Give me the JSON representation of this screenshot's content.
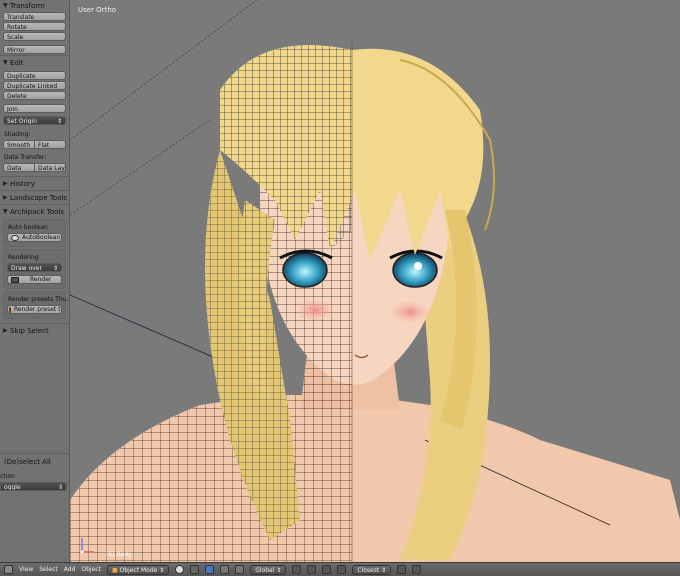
{
  "toolshelf": {
    "transform": {
      "title": "Transform",
      "buttons": [
        "Translate",
        "Rotate",
        "Scale",
        "Mirror"
      ]
    },
    "edit": {
      "title": "Edit",
      "buttons": [
        "Duplicate",
        "Duplicate Linked",
        "Delete",
        "Join"
      ],
      "set_origin": "Set Origin",
      "shading_label": "Shading:",
      "smooth": "Smooth",
      "flat": "Flat",
      "data_transfer_label": "Data Transfer:",
      "data": "Data",
      "data_layo": "Data Layo"
    },
    "history": "History",
    "landscape_tools": "Landscape Tools",
    "archipack": {
      "title": "Archipack Tools",
      "auto_boolean_label": "Auto boolean",
      "auto_boolean_button": "AutoBoolean",
      "rendering_label": "Rendering",
      "draw_over": "Draw over",
      "render_button": "Render",
      "render_presets_label": "Render presets Thu...",
      "render_preset_button": "Render preset th..."
    },
    "skip_select": "Skip Select",
    "operator": {
      "title": "(De)select All",
      "action_label": "ction",
      "action_value": "oggle"
    }
  },
  "viewport": {
    "title": "User Ortho",
    "object_label": "(6) Body"
  },
  "header": {
    "menus": [
      "View",
      "Select",
      "Add",
      "Object"
    ],
    "mode": "Object Mode",
    "orientation": "Global",
    "snap": "Closest"
  }
}
